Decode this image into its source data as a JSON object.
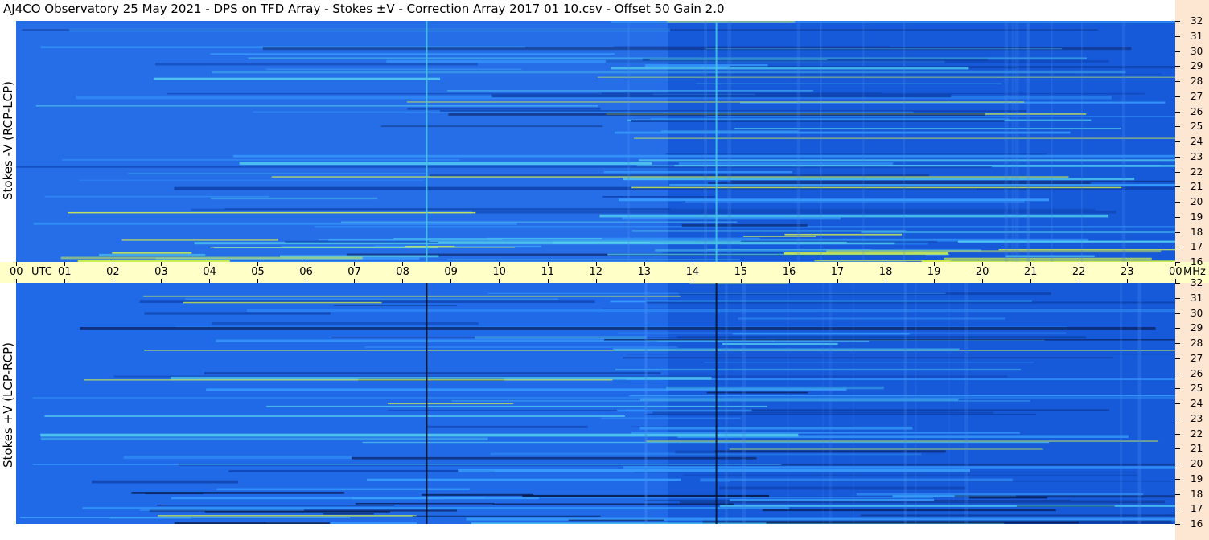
{
  "title": "AJ4CO Observatory  25 May 2021  -  DPS on TFD Array  -  Stokes ±V  -  Correction Array 2017 01 10.csv  -  Offset 50  Gain 2.0",
  "colors": {
    "background_blue": "#1a63e6",
    "time_axis_bg": "#ffffc8",
    "freq_axis_bg": "#fde6d2",
    "cyan_line": "#45c8e6",
    "dark_line": "#06122e",
    "hot": "#e8ff3c"
  },
  "chart_data": [
    {
      "type": "heatmap",
      "panel": "top",
      "ylabel": "Stokes -V (RCP-LCP)",
      "x_ticks": [
        "00",
        "01",
        "02",
        "03",
        "04",
        "05",
        "06",
        "07",
        "08",
        "09",
        "10",
        "11",
        "12",
        "13",
        "14",
        "15",
        "16",
        "17",
        "18",
        "19",
        "20",
        "21",
        "22",
        "23",
        "00"
      ],
      "x_unit": "UTC",
      "xlim_utc_hours": [
        0,
        24
      ],
      "y_ticks": [
        32,
        31,
        30,
        29,
        28,
        27,
        26,
        25,
        24,
        23,
        22,
        21,
        20,
        19,
        18,
        17,
        16
      ],
      "y_unit": "MHz",
      "ylim_mhz": [
        16,
        32
      ],
      "vertical_lines_utc": [
        8.5,
        14.5
      ],
      "vertical_line_style": "cyan"
    },
    {
      "type": "heatmap",
      "panel": "bottom",
      "ylabel": "Stokes +V (LCP-RCP)",
      "x_ticks": [
        "00",
        "01",
        "02",
        "03",
        "04",
        "05",
        "06",
        "07",
        "08",
        "09",
        "10",
        "11",
        "12",
        "13",
        "14",
        "15",
        "16",
        "17",
        "18",
        "19",
        "20",
        "21",
        "22",
        "23",
        "00"
      ],
      "x_unit": "UTC",
      "xlim_utc_hours": [
        0,
        24
      ],
      "y_ticks": [
        32,
        31,
        30,
        29,
        28,
        27,
        26,
        25,
        24,
        23,
        22,
        21,
        20,
        19,
        18,
        17,
        16
      ],
      "y_unit": "MHz",
      "ylim_mhz": [
        16,
        32
      ],
      "vertical_lines_utc": [
        8.5,
        14.5
      ],
      "vertical_line_style": "dark"
    }
  ]
}
